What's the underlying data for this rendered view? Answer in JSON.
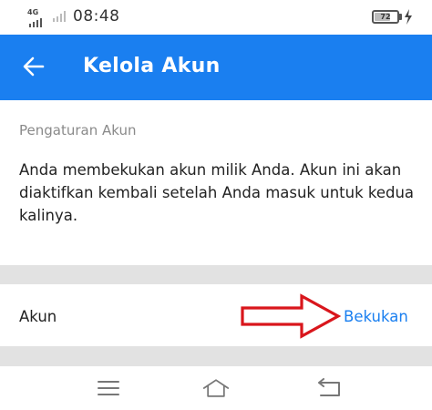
{
  "status_bar": {
    "network": "4G",
    "time": "08:48",
    "battery_level": "72",
    "battery_fraction": 0.72
  },
  "app_bar": {
    "title": "Kelola Akun",
    "back_icon": "arrow-left-icon",
    "color": "#1a7ff0"
  },
  "content": {
    "section_label": "Pengaturan Akun",
    "message": "Anda membekukan akun milik Anda. Akun ini akan diaktifkan kembali setelah Anda masuk untuk kedua kalinya.",
    "row": {
      "label": "Akun",
      "action": "Bekukan",
      "action_color": "#1a7ff0"
    },
    "annotation_color": "#d9161c"
  },
  "nav_bar": {
    "icons": [
      "menu-icon",
      "home-icon",
      "back-icon"
    ]
  }
}
